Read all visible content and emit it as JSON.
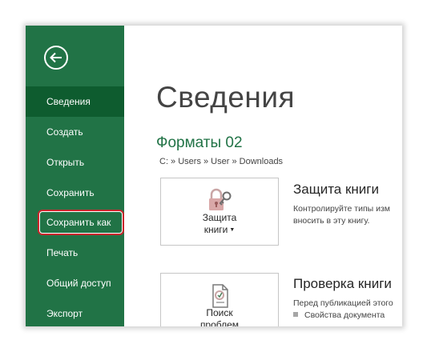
{
  "sidebar": {
    "items": [
      {
        "label": "Сведения",
        "active": true
      },
      {
        "label": "Создать"
      },
      {
        "label": "Открыть"
      },
      {
        "label": "Сохранить"
      },
      {
        "label": "Сохранить как",
        "highlighted": true
      },
      {
        "label": "Печать"
      },
      {
        "label": "Общий доступ"
      },
      {
        "label": "Экспорт"
      }
    ]
  },
  "main": {
    "title": "Сведения",
    "doc_name": "Форматы 02",
    "path": "C: » Users » User » Downloads",
    "protect": {
      "button_line1": "Защита",
      "button_line2": "книги",
      "heading": "Защита книги",
      "desc_line1": "Контролируйте типы изм",
      "desc_line2": "вносить в эту книгу."
    },
    "inspect": {
      "button_line1": "Поиск",
      "button_line2": "проблем",
      "heading": "Проверка книги",
      "desc_line1": "Перед публикацией этого",
      "bullet1": "Свойства документа"
    }
  },
  "colors": {
    "sidebar_bg": "#217346",
    "active_item_bg": "#0e5c2f",
    "highlight_border": "#c9252c",
    "accent_text": "#217346"
  }
}
